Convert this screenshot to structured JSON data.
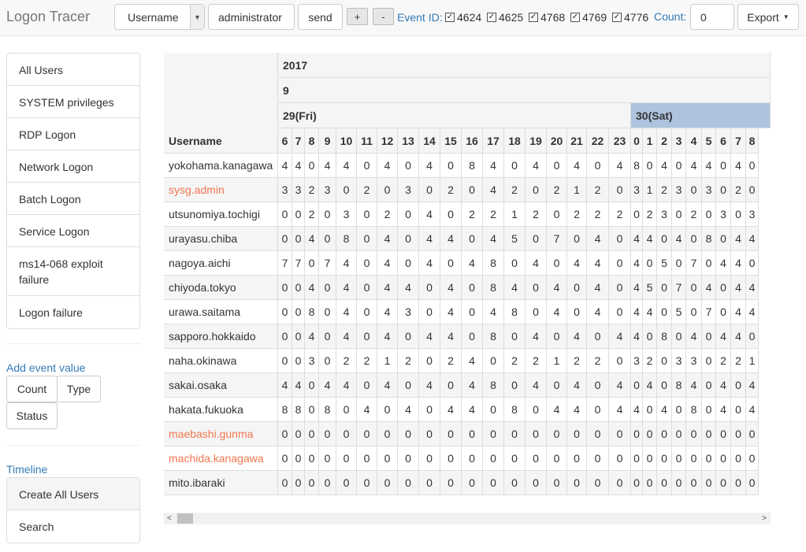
{
  "app": {
    "title": "Logon Tracer"
  },
  "toolbar": {
    "select_value": "Username",
    "input_value": "administrator",
    "send_label": "send",
    "plus_label": "+",
    "minus_label": "-",
    "event_id_label": "Event ID:",
    "event_ids": [
      {
        "id": "4624",
        "checked": true
      },
      {
        "id": "4625",
        "checked": true
      },
      {
        "id": "4768",
        "checked": true
      },
      {
        "id": "4769",
        "checked": true
      },
      {
        "id": "4776",
        "checked": true
      }
    ],
    "count_label": "Count:",
    "count_value": "0",
    "export_label": "Export"
  },
  "sidebar": {
    "items": [
      "All Users",
      "SYSTEM privileges",
      "RDP Logon",
      "Network Logon",
      "Batch Logon",
      "Service Logon",
      "ms14-068 exploit failure",
      "Logon failure"
    ],
    "add_event_label": "Add event value",
    "event_buttons": [
      "Count",
      "Type",
      "Status"
    ],
    "timeline_label": "Timeline",
    "timeline_items": [
      "Create All Users",
      "Search"
    ]
  },
  "colors": {
    "highlight_user": "#f0774f",
    "link": "#337ab7",
    "selected_day": "#adc3de",
    "row_alt": "#f5f5f5"
  },
  "table": {
    "year": "2017",
    "month": "9",
    "days": [
      {
        "label": "29(Fri)",
        "selected": false
      },
      {
        "label": "30(Sat)",
        "selected": true
      }
    ],
    "username_header": "Username",
    "hours_day1": [
      "6",
      "7",
      "8",
      "9",
      "10",
      "11",
      "12",
      "13",
      "14",
      "15",
      "16",
      "17",
      "18",
      "19",
      "20",
      "21",
      "22",
      "23"
    ],
    "hours_day2": [
      "0",
      "1",
      "2",
      "3",
      "4",
      "5",
      "6",
      "7",
      "8"
    ],
    "rows": [
      {
        "user": "yokohama.kanagawa",
        "highlight": false,
        "values": [
          4,
          4,
          0,
          4,
          4,
          0,
          4,
          0,
          4,
          0,
          8,
          4,
          0,
          4,
          0,
          4,
          0,
          4,
          8,
          0,
          4,
          0,
          4,
          4,
          0,
          4,
          0
        ]
      },
      {
        "user": "sysg.admin",
        "highlight": true,
        "values": [
          3,
          3,
          2,
          3,
          0,
          2,
          0,
          3,
          0,
          2,
          0,
          4,
          2,
          0,
          2,
          1,
          2,
          0,
          3,
          1,
          2,
          3,
          0,
          3,
          0,
          2,
          0
        ]
      },
      {
        "user": "utsunomiya.tochigi",
        "highlight": false,
        "values": [
          0,
          0,
          2,
          0,
          3,
          0,
          2,
          0,
          4,
          0,
          2,
          2,
          1,
          2,
          0,
          2,
          2,
          2,
          0,
          2,
          3,
          0,
          2,
          0,
          3,
          0,
          3
        ]
      },
      {
        "user": "urayasu.chiba",
        "highlight": false,
        "values": [
          0,
          0,
          4,
          0,
          8,
          0,
          4,
          0,
          4,
          4,
          0,
          4,
          5,
          0,
          7,
          0,
          4,
          0,
          4,
          4,
          0,
          4,
          0,
          8,
          0,
          4,
          4
        ]
      },
      {
        "user": "nagoya.aichi",
        "highlight": false,
        "values": [
          7,
          7,
          0,
          7,
          4,
          0,
          4,
          0,
          4,
          0,
          4,
          8,
          0,
          4,
          0,
          4,
          4,
          0,
          4,
          0,
          5,
          0,
          7,
          0,
          4,
          4,
          0
        ]
      },
      {
        "user": "chiyoda.tokyo",
        "highlight": false,
        "values": [
          0,
          0,
          4,
          0,
          4,
          0,
          4,
          4,
          0,
          4,
          0,
          8,
          4,
          0,
          4,
          0,
          4,
          0,
          4,
          5,
          0,
          7,
          0,
          4,
          0,
          4,
          4
        ]
      },
      {
        "user": "urawa.saitama",
        "highlight": false,
        "values": [
          0,
          0,
          8,
          0,
          4,
          0,
          4,
          3,
          0,
          4,
          0,
          4,
          8,
          0,
          4,
          0,
          4,
          0,
          4,
          4,
          0,
          5,
          0,
          7,
          0,
          4,
          4
        ]
      },
      {
        "user": "sapporo.hokkaido",
        "highlight": false,
        "values": [
          0,
          0,
          4,
          0,
          4,
          0,
          4,
          0,
          4,
          4,
          0,
          8,
          0,
          4,
          0,
          4,
          0,
          4,
          4,
          0,
          8,
          0,
          4,
          0,
          4,
          4,
          0
        ]
      },
      {
        "user": "naha.okinawa",
        "highlight": false,
        "values": [
          0,
          0,
          3,
          0,
          2,
          2,
          1,
          2,
          0,
          2,
          4,
          0,
          2,
          2,
          1,
          2,
          2,
          0,
          3,
          2,
          0,
          3,
          3,
          0,
          2,
          2,
          1
        ]
      },
      {
        "user": "sakai.osaka",
        "highlight": false,
        "values": [
          4,
          4,
          0,
          4,
          4,
          0,
          4,
          0,
          4,
          0,
          4,
          8,
          0,
          4,
          0,
          4,
          0,
          4,
          0,
          4,
          0,
          8,
          4,
          0,
          4,
          0,
          4
        ]
      },
      {
        "user": "hakata.fukuoka",
        "highlight": false,
        "values": [
          8,
          8,
          0,
          8,
          0,
          4,
          0,
          4,
          0,
          4,
          4,
          0,
          8,
          0,
          4,
          4,
          0,
          4,
          4,
          0,
          4,
          0,
          8,
          0,
          4,
          0,
          4
        ]
      },
      {
        "user": "maebashi.gunma",
        "highlight": true,
        "values": [
          0,
          0,
          0,
          0,
          0,
          0,
          0,
          0,
          0,
          0,
          0,
          0,
          0,
          0,
          0,
          0,
          0,
          0,
          0,
          0,
          0,
          0,
          0,
          0,
          0,
          0,
          0
        ]
      },
      {
        "user": "machida.kanagawa",
        "highlight": true,
        "values": [
          0,
          0,
          0,
          0,
          0,
          0,
          0,
          0,
          0,
          0,
          0,
          0,
          0,
          0,
          0,
          0,
          0,
          0,
          0,
          0,
          0,
          0,
          0,
          0,
          0,
          0,
          0
        ]
      },
      {
        "user": "mito.ibaraki",
        "highlight": false,
        "values": [
          0,
          0,
          0,
          0,
          0,
          0,
          0,
          0,
          0,
          0,
          0,
          0,
          0,
          0,
          0,
          0,
          0,
          0,
          0,
          0,
          0,
          0,
          0,
          0,
          0,
          0,
          0
        ]
      }
    ]
  }
}
